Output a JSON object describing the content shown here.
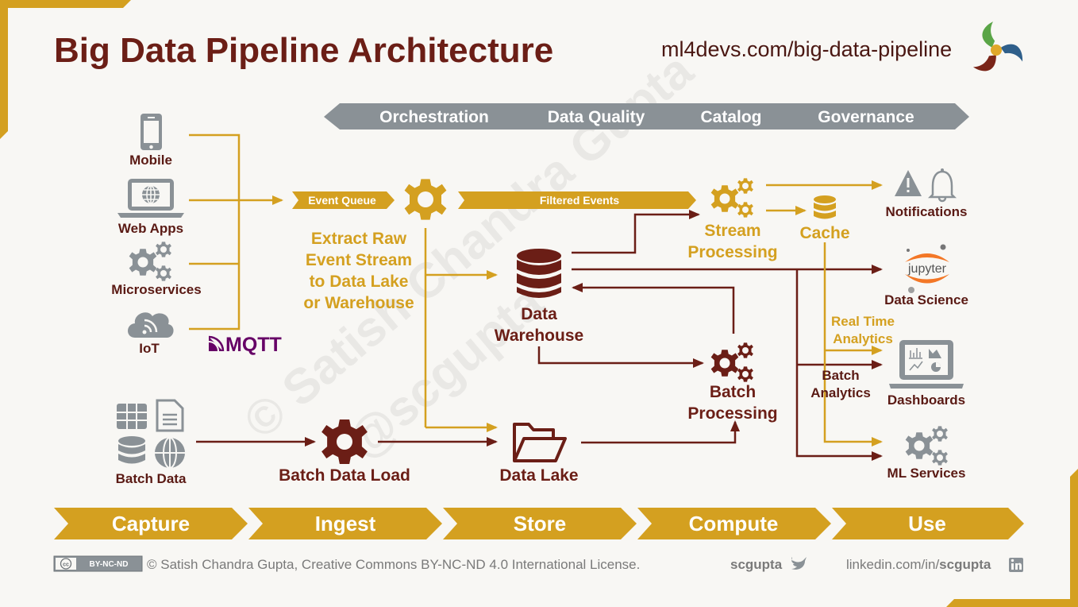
{
  "header": {
    "title": "Big Data Pipeline Architecture",
    "url": "ml4devs.com/big-data-pipeline",
    "logo": "ml4devs-pinwheel-logo"
  },
  "colors": {
    "gold": "#d4a020",
    "maroon": "#6b1e16",
    "gray": "#8a9196",
    "mqtt_purple": "#660066",
    "background": "#f8f7f4"
  },
  "cross_cutting_band": {
    "items": [
      "Orchestration",
      "Data Quality",
      "Catalog",
      "Governance"
    ]
  },
  "sources": {
    "streaming": [
      {
        "label": "Mobile",
        "icon": "mobile-phone-icon"
      },
      {
        "label": "Web Apps",
        "icon": "laptop-globe-icon"
      },
      {
        "label": "Microservices",
        "icon": "gears-icon"
      },
      {
        "label": "IoT",
        "icon": "cloud-signal-icon"
      }
    ],
    "protocol_logo": "MQTT",
    "batch": {
      "label": "Batch Data",
      "icons": [
        "table-icon",
        "document-icon",
        "database-icon",
        "globe-icon"
      ]
    }
  },
  "flow_labels": {
    "event_queue": "Event Queue",
    "filtered_events": "Filtered Events",
    "extract": [
      "Extract Raw",
      "Event Stream",
      "to Data Lake",
      "or Warehouse"
    ],
    "real_time": [
      "Real Time",
      "Analytics"
    ],
    "batch_analytics": [
      "Batch",
      "Analytics"
    ]
  },
  "nodes": {
    "batch_data_load": "Batch Data Load",
    "data_warehouse": [
      "Data",
      "Warehouse"
    ],
    "data_lake": "Data Lake",
    "stream_processing": [
      "Stream",
      "Processing"
    ],
    "cache": "Cache",
    "batch_processing": [
      "Batch",
      "Processing"
    ]
  },
  "consumers": [
    {
      "label": "Notifications",
      "icon": "warning-bell-icon"
    },
    {
      "label": "Data Science",
      "icon": "jupyter-icon",
      "logo_text": "jupyter"
    },
    {
      "label": "Dashboards",
      "icon": "laptop-charts-icon"
    },
    {
      "label": "ML Services",
      "icon": "gears-icon"
    }
  ],
  "stages": [
    "Capture",
    "Ingest",
    "Store",
    "Compute",
    "Use"
  ],
  "watermark": [
    "© Satish Chandra Gupta",
    "@scgupta"
  ],
  "footer": {
    "license_badge": "BY-NC-ND",
    "license_badge_cc": "cc",
    "license_text": "© Satish Chandra Gupta, Creative Commons BY-NC-ND 4.0 International License.",
    "twitter_handle": "scgupta",
    "linkedin_prefix": "linkedin.com/in/",
    "linkedin_handle": "scgupta"
  }
}
